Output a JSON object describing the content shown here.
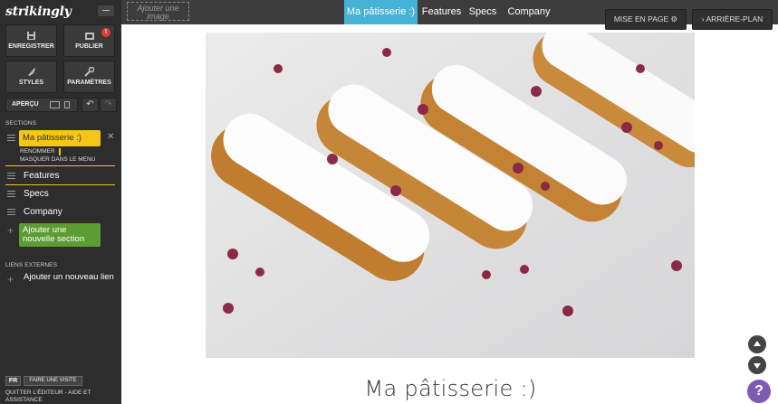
{
  "sidebar": {
    "logo": "strikingly",
    "save_label": "ENREGISTRER",
    "publish_label": "PUBLIER",
    "publish_badge": "!",
    "styles_label": "STYLES",
    "settings_label": "PARAMÈTRES",
    "preview_label": "APERÇU",
    "sections_heading": "SECTIONS",
    "sections": [
      {
        "label": "Ma pâtisserie :)",
        "active": true
      },
      {
        "label": "Features"
      },
      {
        "label": "Specs"
      },
      {
        "label": "Company"
      }
    ],
    "rename_label": "RENOMMER",
    "hide_menu_label": "MASQUER DANS LE MENU",
    "add_section_label": "Ajouter une nouvelle section",
    "external_links_heading": "LIENS EXTERNES",
    "add_link_label": "Ajouter un nouveau lien",
    "language": "FR",
    "tour_label": "FAIRE UNE VISITE",
    "quit_label": "QUITTER L'ÉDITEUR - AIDE ET ASSISTANCE"
  },
  "topnav": {
    "add_image_label": "Ajouter une image",
    "items": [
      "Ma pâtisserie :)",
      "Features",
      "Specs",
      "Company"
    ],
    "active_index": 0
  },
  "toolbar": {
    "layout_label": "MISE EN PAGE ⚙",
    "background_label": "› ARRIÈRE-PLAN"
  },
  "main": {
    "title": "Ma pâtisserie :)"
  },
  "colors": {
    "accent_blue": "#46b3d6",
    "section_yellow": "#f5c518",
    "add_green": "#5d9c32",
    "help_purple": "#7e5bb3"
  },
  "help_label": "?"
}
